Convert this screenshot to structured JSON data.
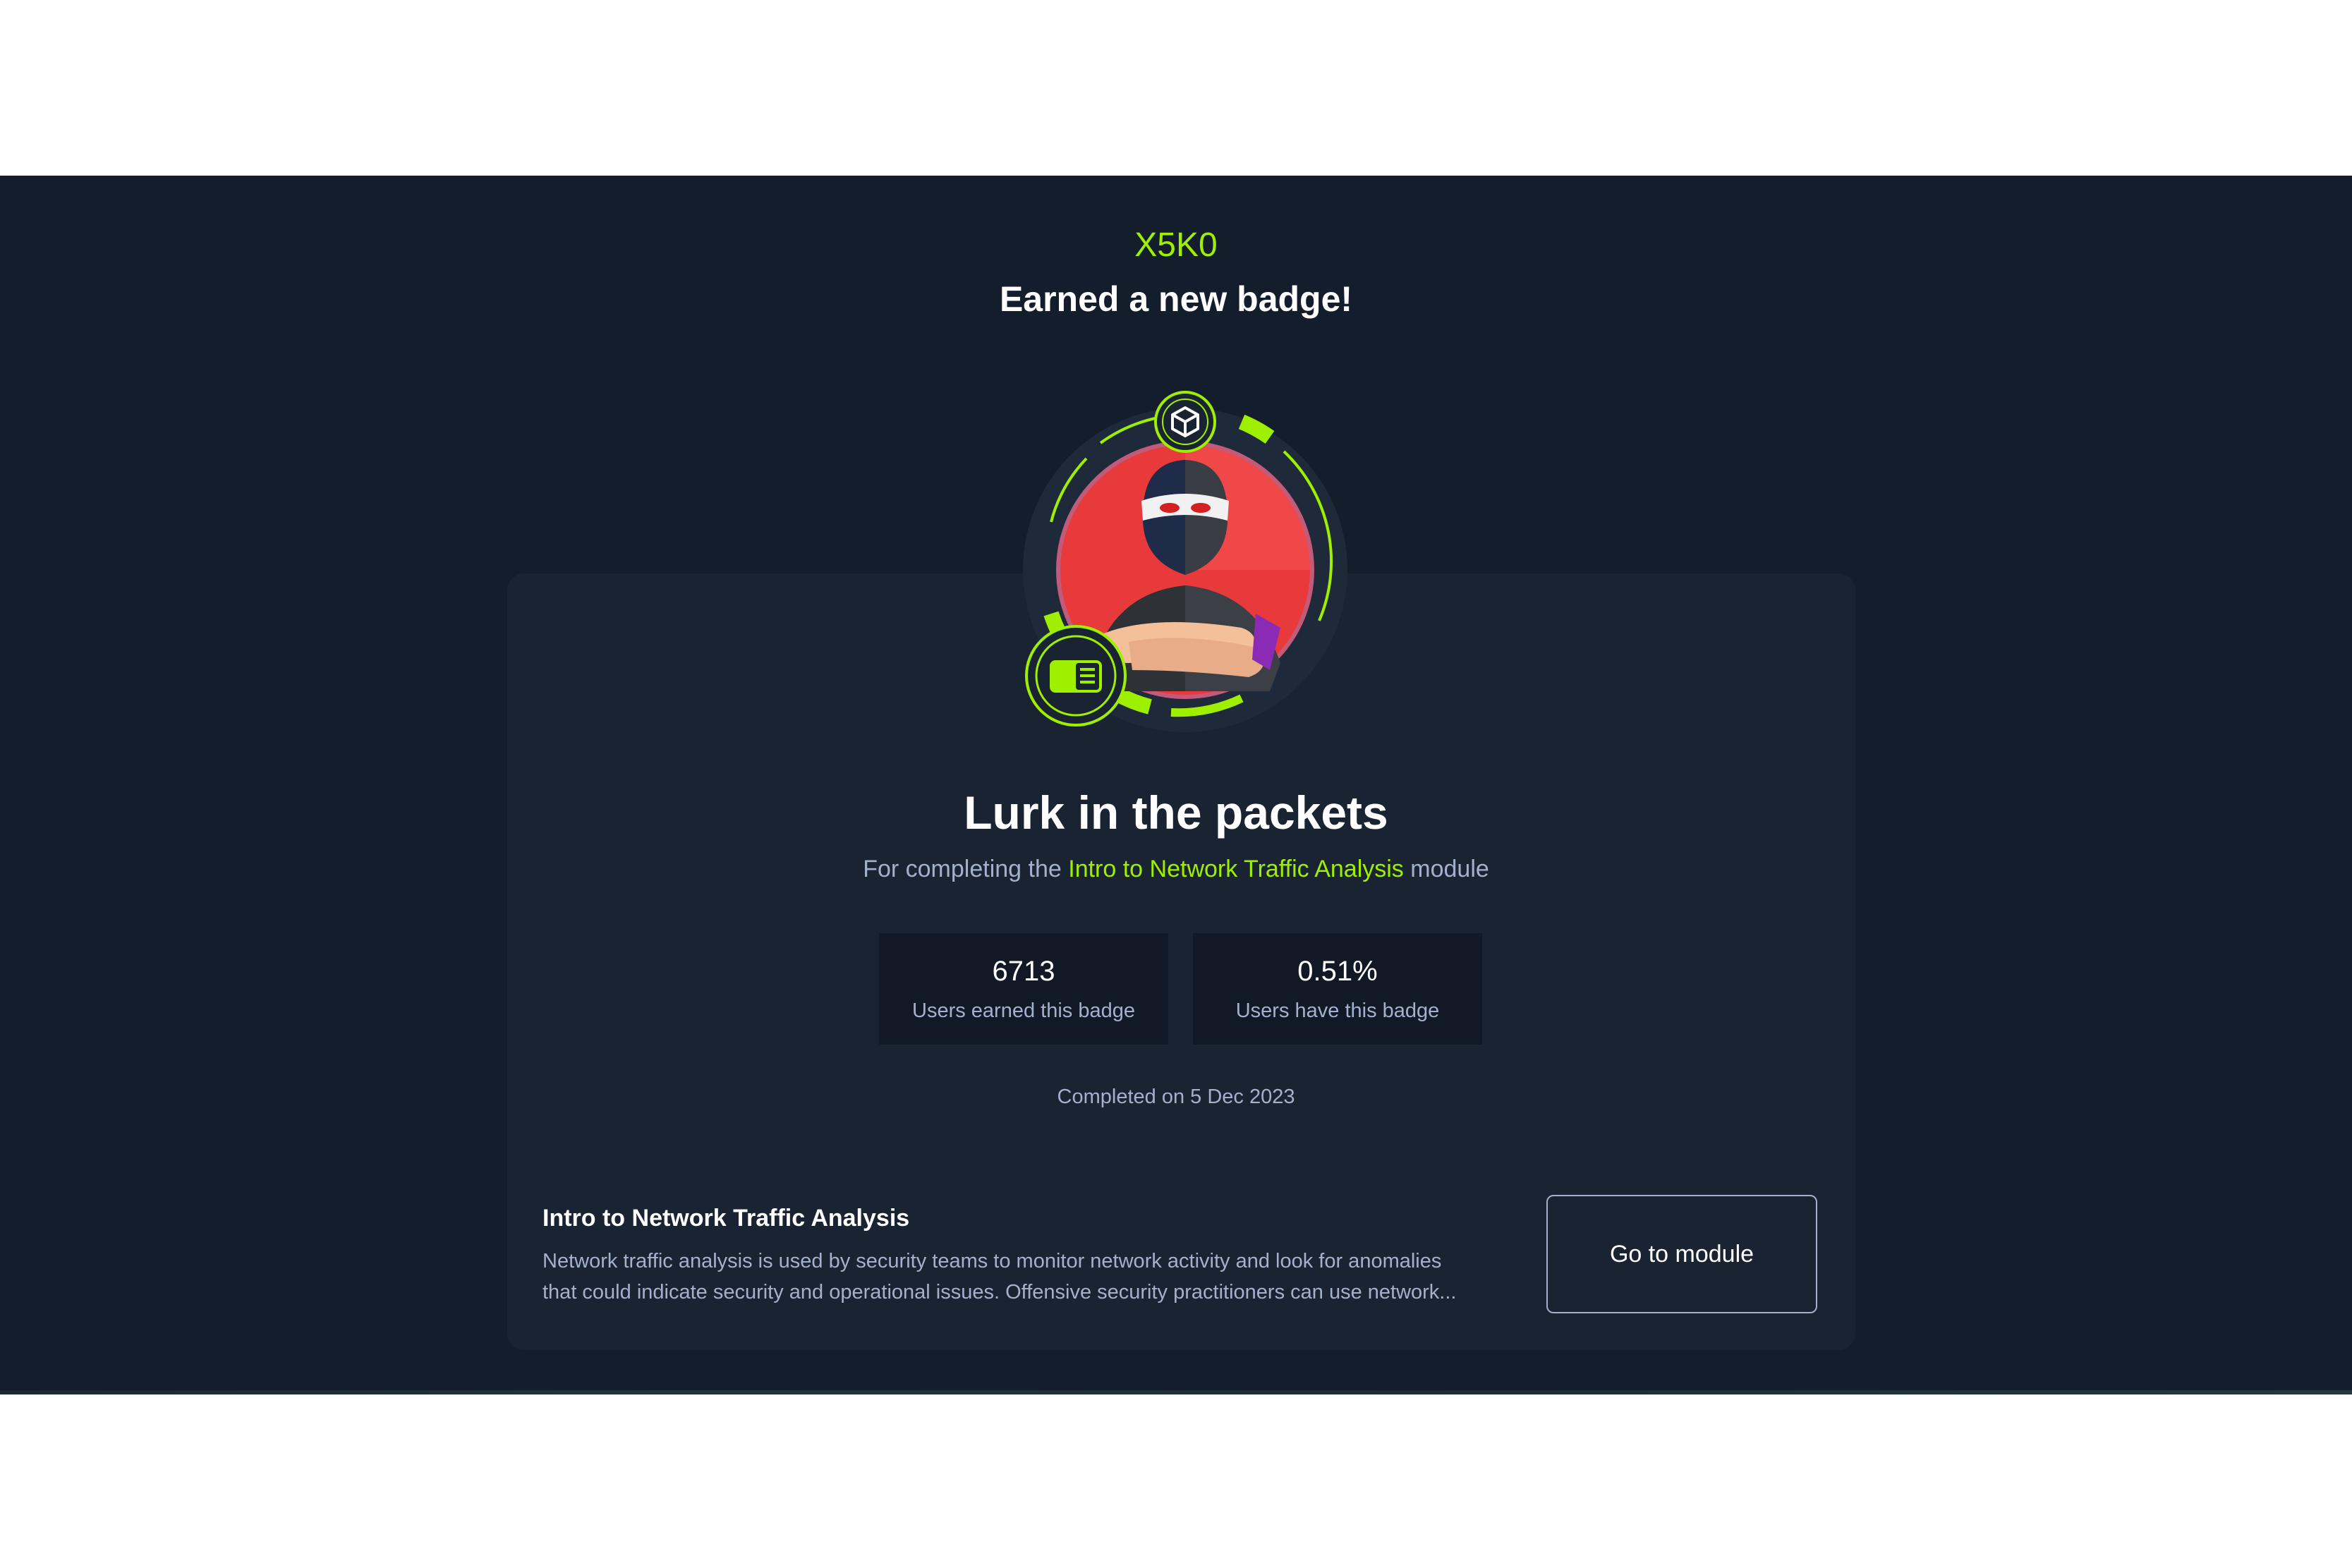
{
  "header": {
    "username": "X5K0",
    "headline": "Earned a new badge!"
  },
  "badge": {
    "title": "Lurk in the packets",
    "desc_prefix": "For completing the",
    "desc_module": "Intro to Network Traffic Analysis",
    "desc_suffix": "module",
    "icons": [
      "cube-icon",
      "module-card-icon"
    ],
    "colors": {
      "accent": "#9fef00",
      "badge_red": "#e83a3a",
      "ring_dark": "#1e2a3a"
    }
  },
  "stats": [
    {
      "value": "6713",
      "label": "Users earned this badge"
    },
    {
      "value": "0.51%",
      "label": "Users have this badge"
    }
  ],
  "completed": "Completed on 5 Dec 2023",
  "module": {
    "title": "Intro to Network Traffic Analysis",
    "description": "Network traffic analysis is used by security teams to monitor network activity and look for anomalies that could indicate security and operational issues. Offensive security practitioners can use network...",
    "button_label": "Go to module"
  },
  "colors": {
    "page_bg": "#141d2b",
    "card_bg": "#1a2332",
    "stat_bg": "#111927",
    "text_muted": "#a4b1cd",
    "accent": "#9fef00"
  }
}
